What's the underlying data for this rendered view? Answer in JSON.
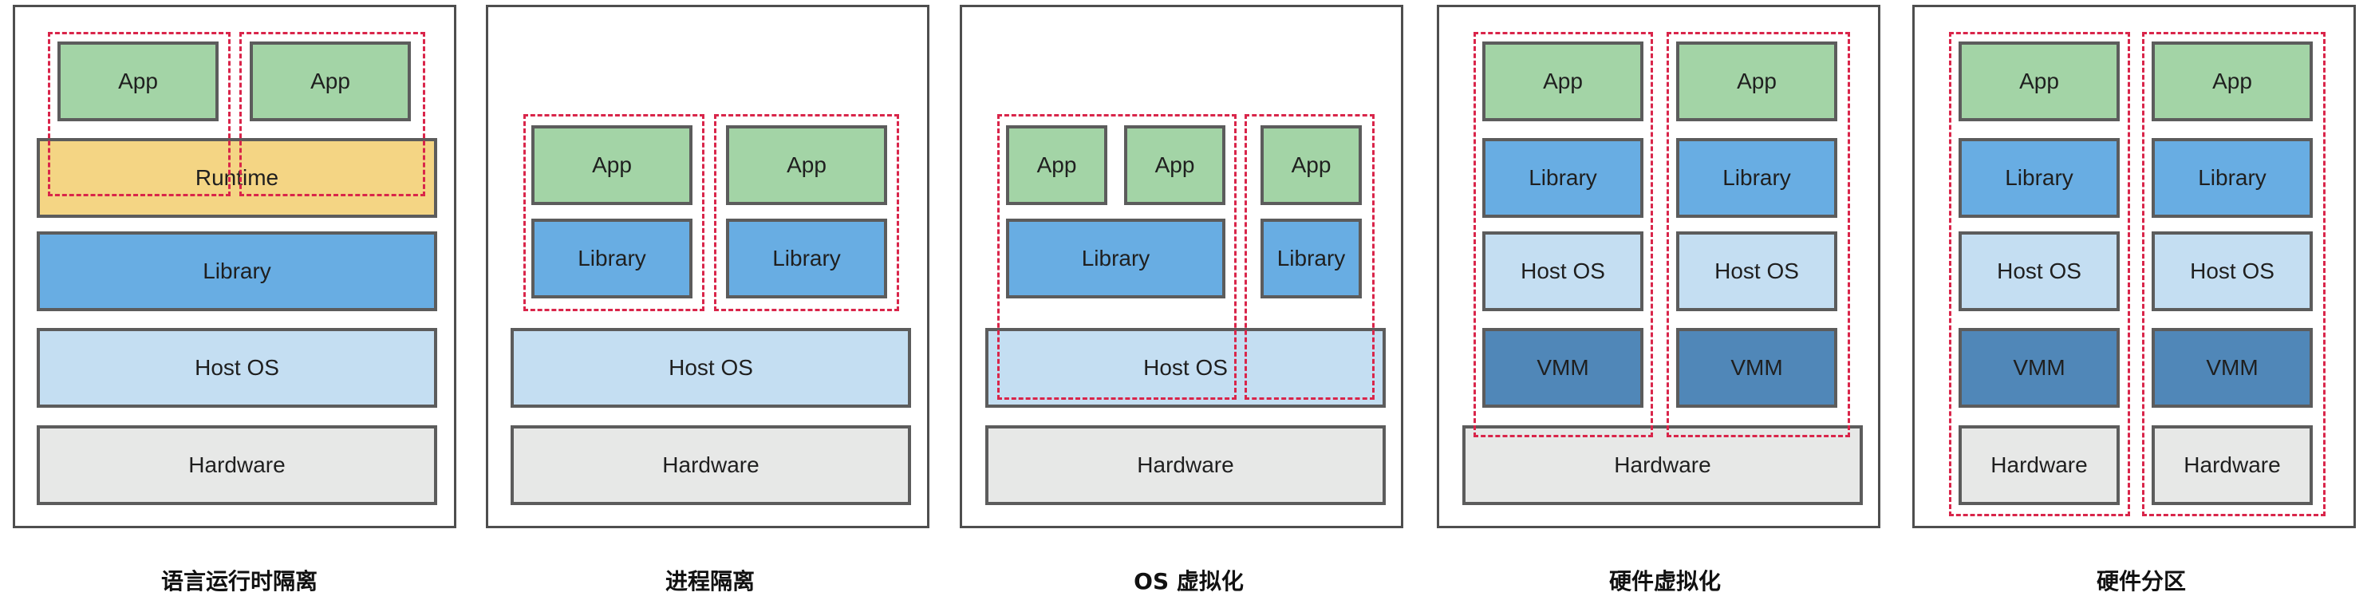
{
  "layers": {
    "app": "App",
    "runtime": "Runtime",
    "library": "Library",
    "host_os": "Host OS",
    "hardware": "Hardware",
    "vmm": "VMM"
  },
  "captions": [
    "语言运行时隔离",
    "进程隔离",
    "OS 虚拟化",
    "硬件虚拟化",
    "硬件分区"
  ],
  "colors": {
    "app": "#a3d4a6",
    "runtime": "#f4d584",
    "library": "#68ade3",
    "host_os": "#c4def2",
    "hardware": "#e7e8e7",
    "vmm": "#5087b8",
    "isolation_boundary": "#d9254a"
  }
}
